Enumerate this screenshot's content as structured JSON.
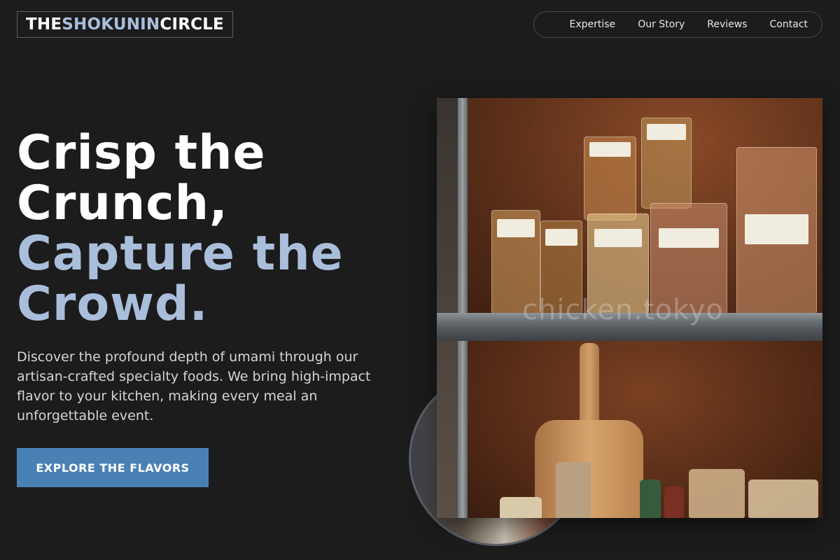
{
  "brand": {
    "part1": "THE ",
    "part2": "SHOKUNIN",
    "part3": " CIRCLE"
  },
  "nav": {
    "items": [
      {
        "label": "Expertise"
      },
      {
        "label": "Our Story"
      },
      {
        "label": "Reviews"
      },
      {
        "label": "Contact"
      }
    ]
  },
  "hero": {
    "headline_line1": "Crisp the",
    "headline_line2": "Crunch,",
    "headline_line3": "Capture the",
    "headline_line4": "Crowd.",
    "description": "Discover the profound depth of umami through our artisan-crafted specialty foods. We bring high-impact flavor to your kitchen, making every meal an unforgettable event.",
    "cta_label": "EXPLORE THE FLAVORS"
  },
  "photo": {
    "watermark": "chicken.tokyo"
  },
  "colors": {
    "background": "#1c1c1d",
    "accent_text": "#a9bedb",
    "cta_background": "#4a81b5"
  }
}
